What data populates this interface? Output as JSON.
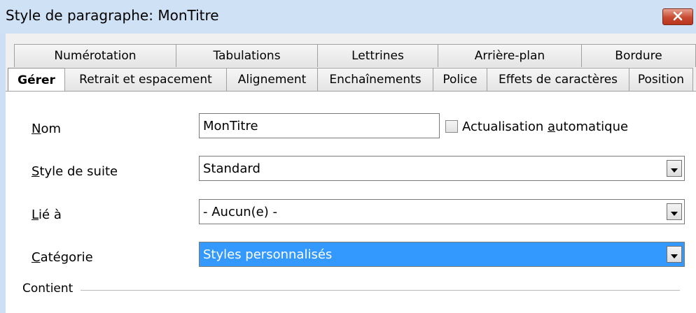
{
  "window": {
    "title": "Style de paragraphe: MonTitre"
  },
  "tabs": {
    "row_back": [
      {
        "label": "Numérotation"
      },
      {
        "label": "Tabulations"
      },
      {
        "label": "Lettrines"
      },
      {
        "label": "Arrière-plan"
      },
      {
        "label": "Bordure"
      }
    ],
    "row_front": [
      {
        "label": "Gérer",
        "active": true
      },
      {
        "label": "Retrait et espacement"
      },
      {
        "label": "Alignement"
      },
      {
        "label": "Enchaînements"
      },
      {
        "label": "Police"
      },
      {
        "label": "Effets de caractères"
      },
      {
        "label": "Position"
      }
    ]
  },
  "form": {
    "name": {
      "label_mnemonic": "N",
      "label_rest": "om",
      "value": "MonTitre"
    },
    "auto_update": {
      "label_before": "Actualisation ",
      "label_mnemonic": "a",
      "label_after": "utomatique",
      "checked": false
    },
    "next_style": {
      "label_mnemonic": "S",
      "label_rest": "tyle de suite",
      "value": "Standard"
    },
    "linked_to": {
      "label_mnemonic": "L",
      "label_rest": "ié à",
      "value": "- Aucun(e) -"
    },
    "category": {
      "label_mnemonic": "C",
      "label_rest": "atégorie",
      "value": "Styles personnalisés"
    },
    "contains": {
      "label": "Contient"
    }
  },
  "colors": {
    "title_bg": "#cfe1f4",
    "close_button": "#c74a30",
    "selection": "#3399ff"
  },
  "icons": {
    "close": "close-x-icon",
    "dropdown": "chevron-down-icon"
  }
}
